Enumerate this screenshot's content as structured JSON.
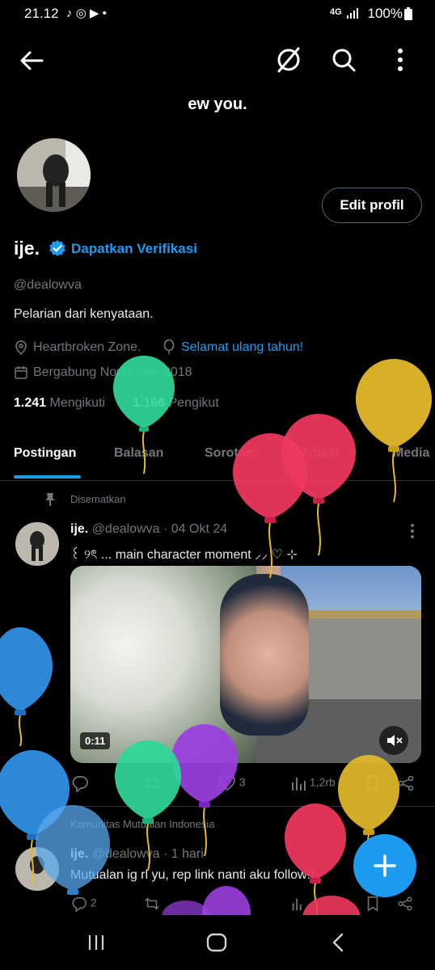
{
  "status_bar": {
    "time": "21.12",
    "battery": "100%",
    "network": "4G"
  },
  "header": {
    "title": "ew you."
  },
  "profile": {
    "edit_label": "Edit profil",
    "name": "ije.",
    "verify_label": "Dapatkan Verifikasi",
    "handle": "@dealowva",
    "bio": "Pelarian dari kenyataan.",
    "location": "Heartbroken Zone.",
    "birthday_link": "Selamat ulang tahun!",
    "joined": "Bergabung November 2018",
    "following_count": "1.241",
    "following_label": "Mengikuti",
    "followers_count": "1.166",
    "followers_label": "Pengikut"
  },
  "tabs": [
    "Postingan",
    "Balasan",
    "Sorotan",
    "Artikel",
    "Media"
  ],
  "pinned_post": {
    "pinned_label": "Disematkan",
    "name": "ije.",
    "handle_time": "@dealowva · 04 Okt 24",
    "text": "꒰ ୨ৎ ... main character moment ⸝⸝ ♡ ⊹",
    "duration": "0:11",
    "likes": "3",
    "views": "1,2rb"
  },
  "second_post": {
    "community": "Komunitas Mutualan Indonesia",
    "name": "ije.",
    "handle_time": "@dealowva · 1 hari",
    "text": "Mutualan ig rl yu, rep link nanti aku follow!!",
    "replies": "2"
  },
  "icons": {
    "back": "arrow-left-icon",
    "grok": "slash-circle-icon",
    "search": "search-icon",
    "more": "more-vertical-icon",
    "verified": "verified-badge-icon",
    "location": "location-pin-icon",
    "balloon": "balloon-icon",
    "calendar": "calendar-icon",
    "pin": "pin-icon",
    "reply": "reply-icon",
    "retweet": "retweet-icon",
    "like": "heart-icon",
    "views": "views-icon",
    "bookmark": "bookmark-icon",
    "share": "share-icon",
    "compose": "plus-icon",
    "recents": "recents-icon",
    "home": "home-icon",
    "nav_back": "nav-back-icon"
  },
  "colors": {
    "accent": "#1d9bf0",
    "background": "#000000",
    "muted": "#71767b",
    "balloon_green": "#2fd898",
    "balloon_yellow": "#e3b92a",
    "balloon_red": "#f0385f",
    "balloon_blue": "#2f8fe4",
    "balloon_purple": "#9b3fe0"
  }
}
